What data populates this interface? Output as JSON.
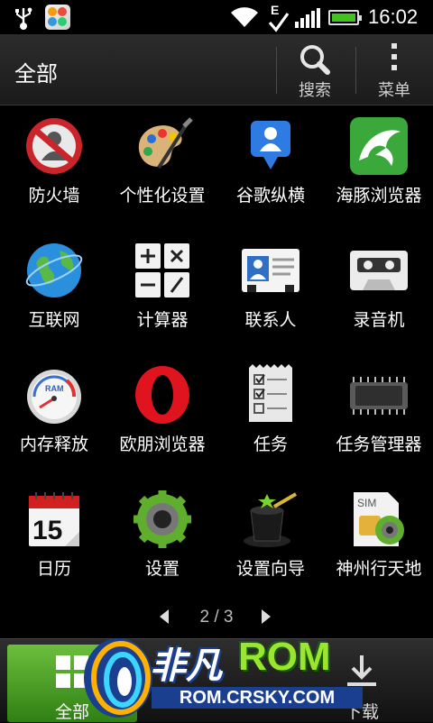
{
  "status_bar": {
    "time": "16:02",
    "network_type": "E",
    "icons": [
      "usb-icon",
      "app-notification-icon",
      "wifi-icon",
      "edge-icon",
      "signal-icon",
      "battery-icon"
    ]
  },
  "header": {
    "title": "全部",
    "search_label": "搜索",
    "menu_label": "菜单"
  },
  "apps": [
    {
      "label": "防火墙",
      "icon": "firewall-icon"
    },
    {
      "label": "个性化设置",
      "icon": "personalize-palette-icon"
    },
    {
      "label": "谷歌纵横",
      "icon": "google-latitude-icon"
    },
    {
      "label": "海豚浏览器",
      "icon": "dolphin-browser-icon"
    },
    {
      "label": "互联网",
      "icon": "internet-globe-icon"
    },
    {
      "label": "计算器",
      "icon": "calculator-icon"
    },
    {
      "label": "联系人",
      "icon": "contacts-card-icon"
    },
    {
      "label": "录音机",
      "icon": "recorder-cassette-icon"
    },
    {
      "label": "内存释放",
      "icon": "ram-gauge-icon"
    },
    {
      "label": "欧朋浏览器",
      "icon": "opera-browser-icon"
    },
    {
      "label": "任务",
      "icon": "tasks-checklist-icon"
    },
    {
      "label": "任务管理器",
      "icon": "task-manager-chip-icon"
    },
    {
      "label": "日历",
      "icon": "calendar-icon",
      "day": "15"
    },
    {
      "label": "设置",
      "icon": "settings-gear-icon"
    },
    {
      "label": "设置向导",
      "icon": "setup-wizard-hat-icon"
    },
    {
      "label": "神州行天地",
      "icon": "sim-toolkit-icon",
      "sim": "SIM"
    }
  ],
  "pager": {
    "text": "2 / 3"
  },
  "bottom_bar": {
    "tabs": [
      {
        "label": "全部",
        "active": true
      },
      {
        "label": "",
        "active": false
      },
      {
        "label": "下载",
        "active": false
      }
    ]
  },
  "watermark": {
    "brand": "非凡",
    "rom": "ROM",
    "url": "ROM.CRSKY.COM"
  },
  "colors": {
    "accent_green": "#3fc41e",
    "tab_active": "#4fa028",
    "background": "#000000"
  }
}
